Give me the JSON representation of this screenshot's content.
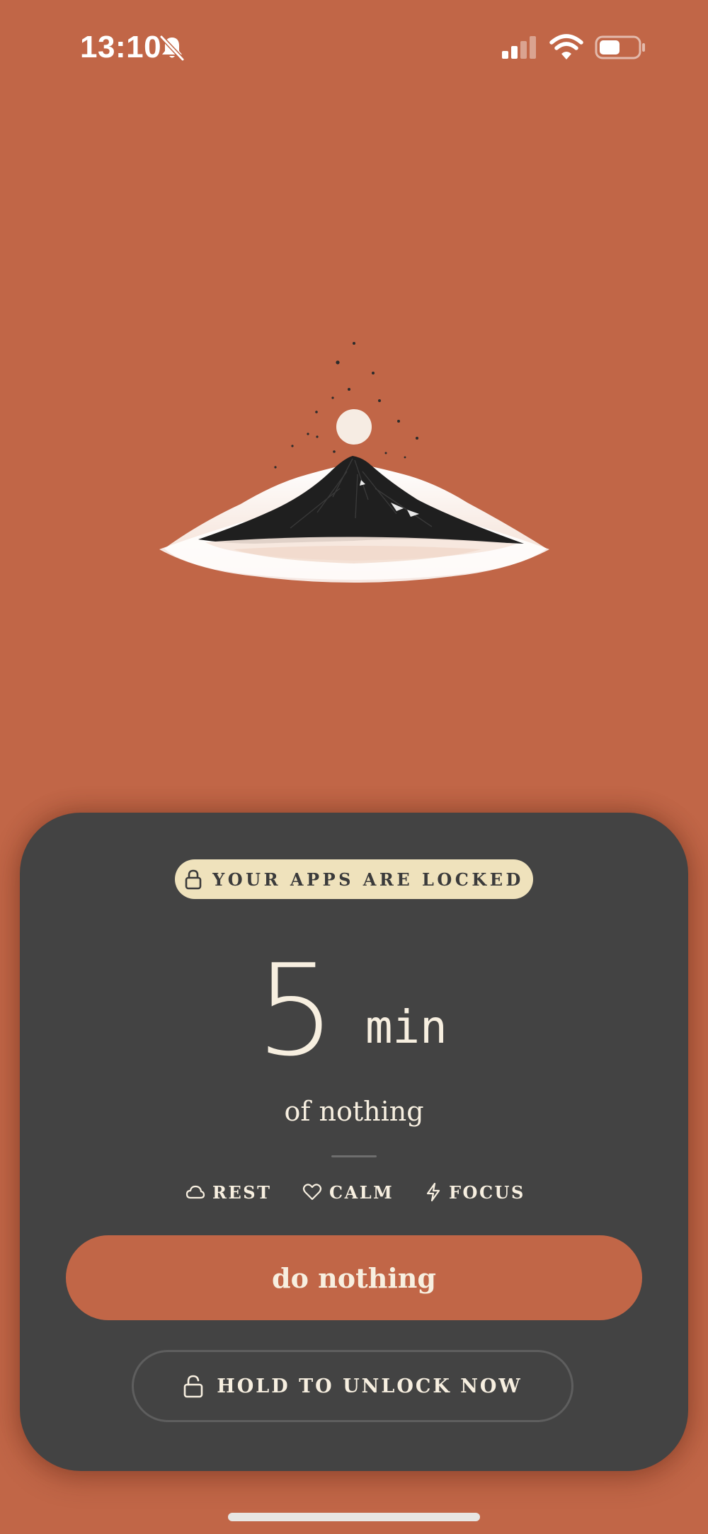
{
  "status_bar": {
    "time": "13:10",
    "icons": [
      "bell-off-icon",
      "signal-icon",
      "wifi-icon",
      "battery-icon"
    ]
  },
  "illustration": {
    "subject": "mountain-with-moon-illustration"
  },
  "lock_card": {
    "badge_label": "YOUR APPS ARE LOCKED",
    "badge_icon": "lock-icon",
    "timer_value": "5",
    "timer_unit": "min",
    "subtitle": "of nothing",
    "tags": [
      {
        "icon": "cloud-icon",
        "label": "REST"
      },
      {
        "icon": "heart-icon",
        "label": "CALM"
      },
      {
        "icon": "bolt-icon",
        "label": "FOCUS"
      }
    ],
    "primary_button_label": "do nothing",
    "unlock_button_label": "HOLD TO UNLOCK NOW",
    "unlock_button_icon": "unlock-icon"
  },
  "colors": {
    "background": "#C16647",
    "card": "#434343",
    "badge": "#EFE2BC",
    "text_light": "#F7EFE0",
    "button_primary": "#C16647"
  }
}
